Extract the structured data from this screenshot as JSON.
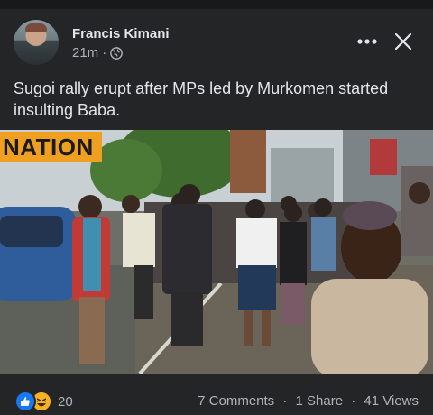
{
  "post": {
    "author": "Francis Kimani",
    "time": "21m",
    "separator": "·",
    "caption": "Sugoi rally erupt after MPs led by Murkomen started insulting Baba.",
    "icons": {
      "audience": "globe-icon",
      "more": "more-options-icon",
      "close": "close-icon"
    }
  },
  "media": {
    "watermark": "NATION"
  },
  "footer": {
    "reaction_count": "20",
    "comments": "7 Comments",
    "shares": "1 Share",
    "views": "41 Views",
    "sep": "·",
    "reactions": [
      "like",
      "haha"
    ]
  },
  "colors": {
    "background": "#242526",
    "text": "#e4e6eb",
    "muted": "#b0b3b8",
    "like": "#1877f2",
    "haha": "#f7b125",
    "nation": "#f0a020"
  }
}
